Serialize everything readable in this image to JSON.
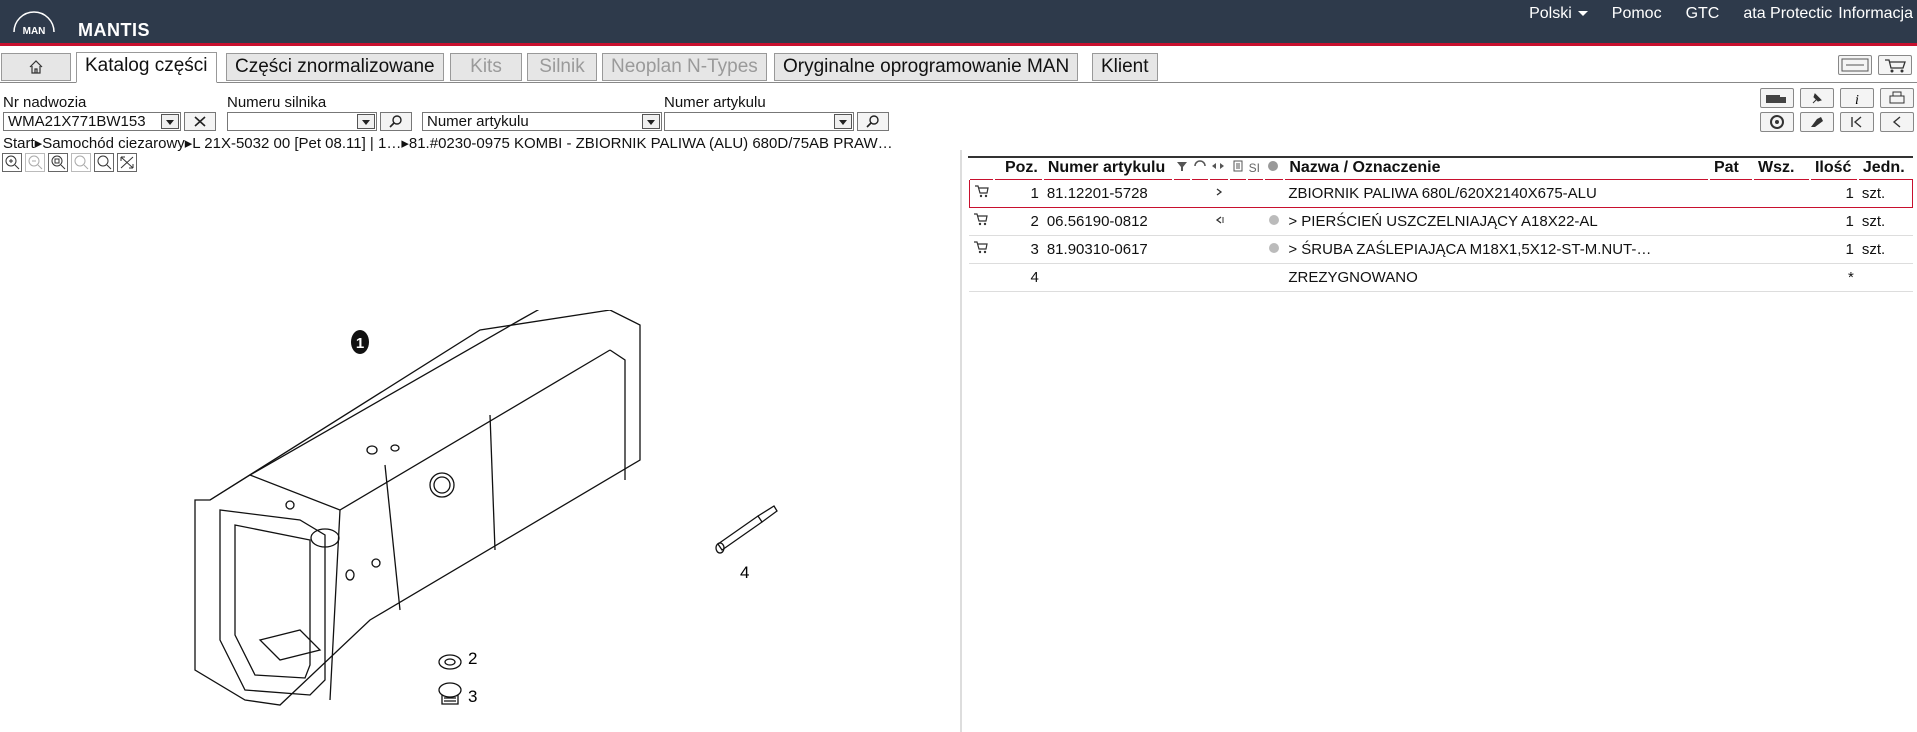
{
  "header": {
    "logo_text": "MAN",
    "app_title": "MANTIS",
    "nav": [
      "Polski",
      "Pomoc",
      "GTC",
      "ata Protectic",
      "Informacja"
    ]
  },
  "tabs": [
    {
      "label": "Katalog części",
      "state": "active"
    },
    {
      "label": "Części znormalizowane",
      "state": "normal"
    },
    {
      "label": "Kits",
      "state": "disabled"
    },
    {
      "label": "Silnik",
      "state": "disabled"
    },
    {
      "label": "Neoplan N-Types",
      "state": "disabled"
    },
    {
      "label": "Oryginalne oprogramowanie MAN",
      "state": "normal"
    },
    {
      "label": "Klient",
      "state": "normal"
    }
  ],
  "filters": {
    "vin_label": "Nr nadwozia",
    "vin_value": "WMA21X771BW153",
    "engine_label": "Numeru silnika",
    "engine_value": "",
    "article_combo_value": "Numer artykulu",
    "article_label": "Numer artykulu",
    "article_value": ""
  },
  "breadcrumb": "Start▸Samochód ciezarowy▸L 21X-5032 00  [Pet 08.11]   | 1…▸81.#0230-0975  KOMBI - ZBIORNIK PALIWA (ALU) 680D/75AB PRAW…",
  "table": {
    "headers": {
      "pos": "Poz.",
      "article": "Numer artykulu",
      "si": "SI",
      "name": "Nazwa / Oznaczenie",
      "pat": "Pat",
      "wsz": "Wsz.",
      "qty": "Ilość",
      "unit": "Jedn."
    },
    "rows": [
      {
        "pos": "1",
        "article": "81.12201-5728",
        "name": "ZBIORNIK PALIWA  680L/620X2140X675-ALU",
        "qty": "1",
        "unit": "szt."
      },
      {
        "pos": "2",
        "article": "06.56190-0812",
        "name": " > PIERŚCIEŃ USZCZELNIAJĄCY  A18X22-AL",
        "qty": "1",
        "unit": "szt."
      },
      {
        "pos": "3",
        "article": "81.90310-0617",
        "name": " > ŚRUBA ZAŚLEPIAJĄCA  M18X1,5X12-ST-M.NUT-…",
        "qty": "1",
        "unit": "szt."
      },
      {
        "pos": "4",
        "article": "",
        "name": "ZREZYGNOWANO",
        "qty": "*",
        "unit": ""
      }
    ]
  },
  "drawing_labels": [
    "1",
    "2",
    "3",
    "4"
  ],
  "colors": {
    "header_bg": "#2e3a4b",
    "accent": "#c8102e"
  }
}
